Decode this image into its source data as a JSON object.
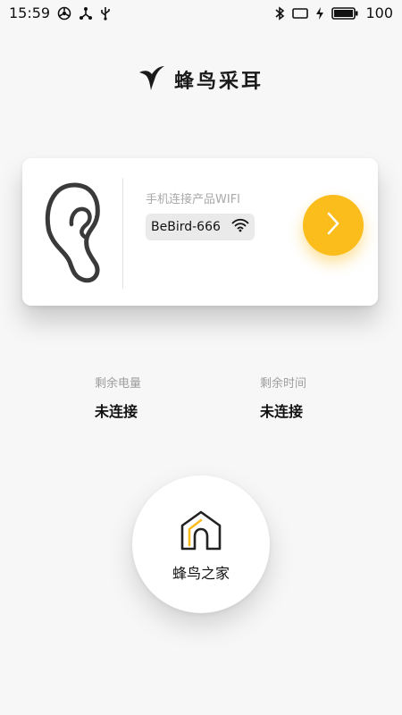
{
  "status_bar": {
    "time": "15:59",
    "battery_level": "100"
  },
  "brand": {
    "name": "蜂鸟采耳"
  },
  "device_card": {
    "wifi_label": "手机连接产品WIFI",
    "wifi_name": "BeBird-666"
  },
  "stats": {
    "battery": {
      "label": "剩余电量",
      "value": "未连接"
    },
    "time": {
      "label": "剩余时间",
      "value": "未连接"
    }
  },
  "home_button": {
    "label": "蜂鸟之家"
  },
  "colors": {
    "accent": "#fbbd1c",
    "background": "#f7f7f7",
    "card": "#ffffff"
  },
  "icons": [
    "sync-icon",
    "usb-tether-icon",
    "usb-icon",
    "bluetooth-icon",
    "screen-icon",
    "charging-icon",
    "battery-icon",
    "hummingbird-logo-icon",
    "ear-icon",
    "wifi-icon",
    "chevron-right-icon",
    "home-icon"
  ]
}
